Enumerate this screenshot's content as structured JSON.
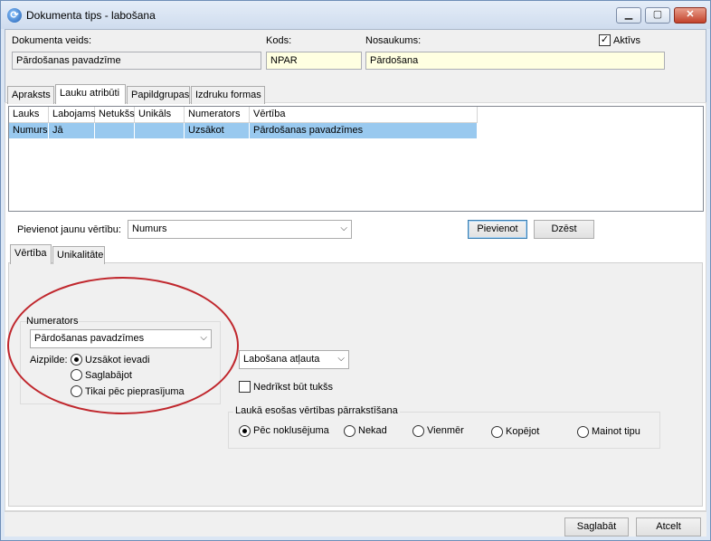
{
  "window": {
    "title": "Dokumenta tips - labošana",
    "app_icon": "app-logo-icon",
    "caption": {
      "min": "▁",
      "max": "▢",
      "close": "✕"
    }
  },
  "header": {
    "doc_type_label": "Dokumenta veids:",
    "doc_type_value": "Pārdošanas pavadzīme",
    "code_label": "Kods:",
    "code_value": "NPAR",
    "name_label": "Nosaukums:",
    "name_value": "Pārdošana",
    "active_label": "Aktīvs",
    "active_checked": true
  },
  "tabs": [
    {
      "label": "Apraksts",
      "active": false
    },
    {
      "label": "Lauku atribūti",
      "active": true
    },
    {
      "label": "Papildgrupas",
      "active": false
    },
    {
      "label": "Izdruku formas",
      "active": false
    }
  ],
  "grid": {
    "columns": [
      "Lauks",
      "Labojams",
      "Netukšs",
      "Unikāls",
      "Numerators",
      "Vērtība"
    ],
    "rows": [
      [
        "Numurs",
        "Jā",
        "",
        "",
        "Uzsākot",
        "Pārdošanas pavadzīmes"
      ]
    ]
  },
  "add_value": {
    "label": "Pievienot jaunu vērtību:",
    "selected": "Numurs",
    "add_button": "Pievienot",
    "delete_button": "Dzēst"
  },
  "subtabs": [
    {
      "label": "Vērtība",
      "active": true
    },
    {
      "label": "Unikalitāte",
      "active": false
    }
  ],
  "numerator": {
    "group_title": "Numerators",
    "selected": "Pārdošanas pavadzīmes",
    "fill_label": "Aizpilde:",
    "options": [
      {
        "label": "Uzsākot ievadi",
        "checked": true
      },
      {
        "label": "Saglabājot",
        "checked": false
      },
      {
        "label": "Tikai pēc pieprasījuma",
        "checked": false
      }
    ]
  },
  "editing": {
    "selected": "Labošana atļauta",
    "not_empty_label": "Nedrīkst būt tukšs",
    "not_empty_checked": false
  },
  "overwrite": {
    "group_title": "Laukā esošas vērtības pārrakstīšana",
    "options": [
      {
        "label": "Pēc noklusējuma",
        "checked": true
      },
      {
        "label": "Nekad",
        "checked": false
      },
      {
        "label": "Vienmēr",
        "checked": false
      },
      {
        "label": "Kopējot",
        "checked": false
      },
      {
        "label": "Mainot tipu",
        "checked": false
      }
    ]
  },
  "footer": {
    "save_button": "Saglabāt",
    "cancel_button": "Atcelt"
  },
  "annotation": {
    "color": "#c0272d"
  }
}
